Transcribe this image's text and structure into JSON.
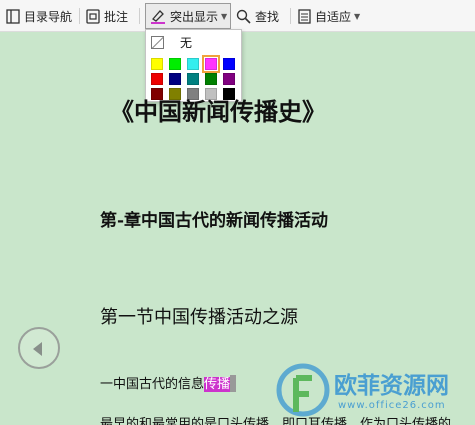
{
  "toolbar": {
    "toc_label": "目录导航",
    "annotate_label": "批注",
    "highlight_label": "突出显示",
    "find_label": "查找",
    "fit_label": "自适应"
  },
  "highlight_menu": {
    "none_label": "无",
    "swatch_colors": [
      "#ffff00",
      "#00ee00",
      "#33eeee",
      "#ff33ff",
      "#0000ff",
      "#ee0000",
      "#000080",
      "#008080",
      "#008000",
      "#800080",
      "#800000",
      "#808000",
      "#808080",
      "#c0c0c0",
      "#000000"
    ],
    "selected_index": 3
  },
  "document": {
    "title": "《中国新闻传播史》",
    "chapter": "第-章中国古代的新闻传播活动",
    "section": "第一节中国传播活动之源",
    "para1_prefix": "一中国古代的信息",
    "para1_highlight": "传播",
    "para2": "最早的和最常用的是口头传播，即口耳传播，作为口头传播的"
  },
  "watermark": {
    "name": "欧菲资源网",
    "url": "www.office26.com"
  }
}
